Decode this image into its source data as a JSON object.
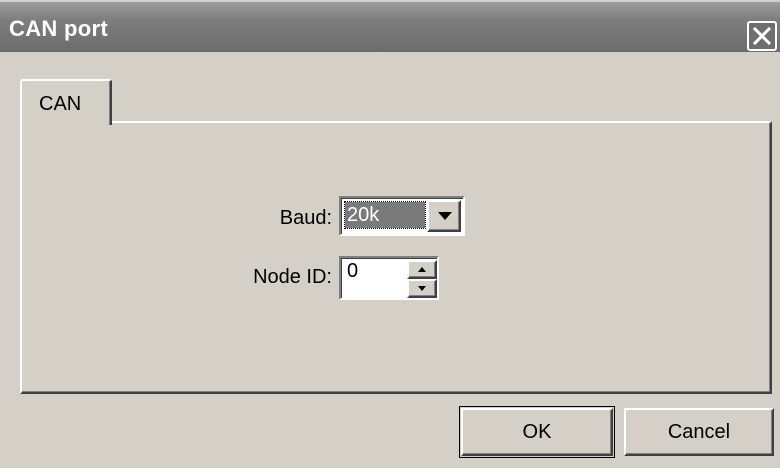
{
  "dialog": {
    "title": "CAN port"
  },
  "tabs": [
    {
      "label": "CAN",
      "selected": true
    }
  ],
  "fields": {
    "baud": {
      "label": "Baud:",
      "value": "20k"
    },
    "node_id": {
      "label": "Node ID:",
      "value": "0"
    }
  },
  "buttons": {
    "ok": "OK",
    "cancel": "Cancel"
  },
  "icons": {
    "close": "close-icon",
    "dropdown": "chevron-down-icon",
    "spin_up": "spin-up-icon",
    "spin_down": "spin-down-icon"
  },
  "colors": {
    "titlebar": "#7e7e7e",
    "face": "#d4d0c8",
    "selection": "#7a7a7a"
  }
}
